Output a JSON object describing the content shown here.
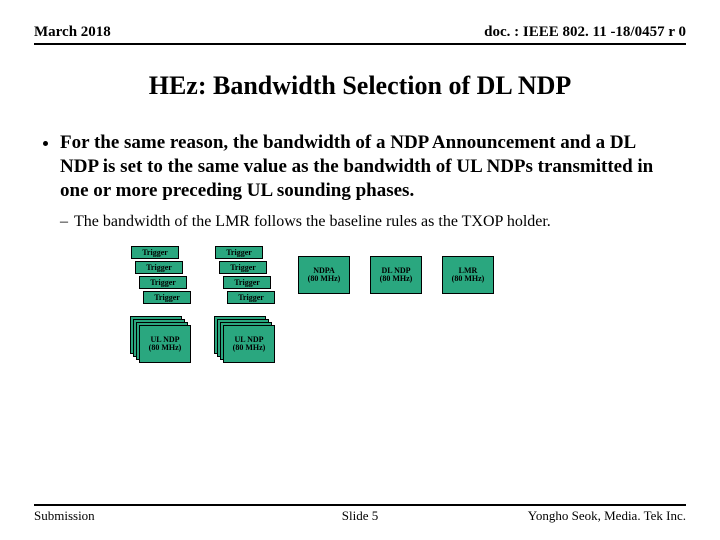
{
  "header": {
    "date": "March 2018",
    "doc": "doc. : IEEE 802. 11 -18/0457 r 0"
  },
  "title": "HEz: Bandwidth Selection of DL NDP",
  "bullet": "For the same reason, the bandwidth of a NDP Announcement and a DL NDP is set to the same value as the bandwidth of UL NDPs transmitted in one or more preceding UL sounding phases.",
  "subbullet": "The bandwidth of the LMR follows the baseline rules as the TXOP holder.",
  "diagram": {
    "trigger_label": "Trigger",
    "ulndp": "UL NDP\n(80 MHz)",
    "ndpa": "NDPA\n(80 MHz)",
    "dlndp": "DL NDP\n(80 MHz)",
    "lmr": "LMR\n(80 MHz)"
  },
  "footer": {
    "left": "Submission",
    "slide": "Slide 5",
    "right": "Yongho Seok, Media. Tek Inc."
  }
}
